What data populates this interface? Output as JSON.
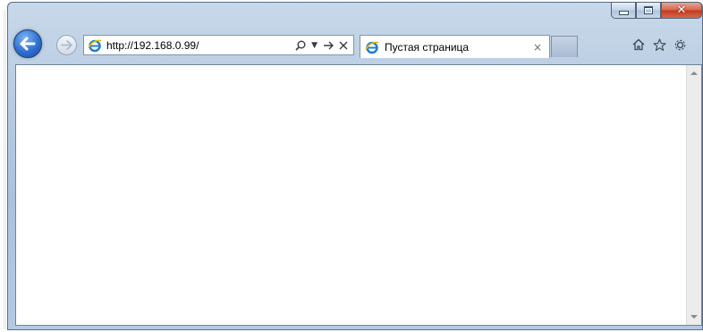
{
  "window": {
    "minimize_icon": "minimize-icon",
    "maximize_icon": "maximize-icon",
    "close_glyph": "✕"
  },
  "navigation": {
    "back_icon": "back-arrow-icon",
    "forward_icon": "forward-arrow-icon"
  },
  "address_bar": {
    "url": "http://192.168.0.99/",
    "search_icon": "search-icon",
    "dropdown_icon": "dropdown-arrow-icon",
    "go_icon": "go-arrow-icon",
    "stop_icon": "stop-icon"
  },
  "tabs": [
    {
      "title": "Пустая страница",
      "close_glyph": "×",
      "icon": "ie-icon"
    }
  ],
  "commands": {
    "home_icon": "home-icon",
    "favorites_icon": "favorites-star-icon",
    "tools_icon": "tools-gear-icon"
  },
  "colors": {
    "frame": "#b7cbe2",
    "back_button": "#2f6fd0",
    "close_button": "#c2391f",
    "content_bg": "#ffffff"
  }
}
